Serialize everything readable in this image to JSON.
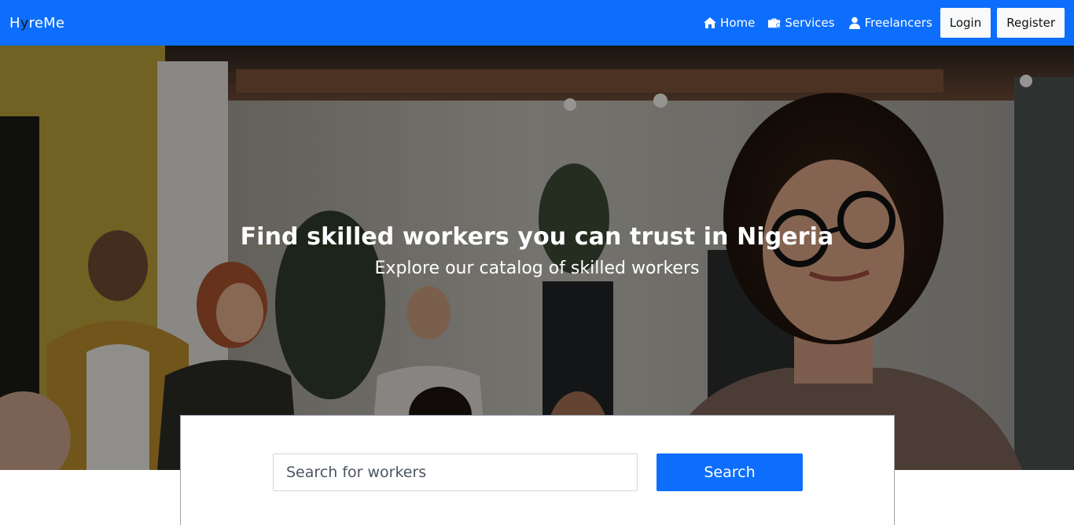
{
  "brand": {
    "h": "H",
    "y": "y",
    "rest": "reMe"
  },
  "nav": {
    "home": {
      "label": "Home",
      "icon": "home-icon"
    },
    "services": {
      "label": "Services",
      "icon": "briefcase-icon"
    },
    "freelancers": {
      "label": "Freelancers",
      "icon": "user-icon"
    },
    "login": "Login",
    "register": "Register"
  },
  "hero": {
    "title": "Find skilled workers you can trust in Nigeria",
    "subtitle": "Explore our catalog of skilled workers"
  },
  "search": {
    "placeholder": "Search for workers",
    "value": "",
    "button": "Search"
  },
  "colors": {
    "primary": "#0d6efd",
    "light": "#f8f9fa"
  }
}
